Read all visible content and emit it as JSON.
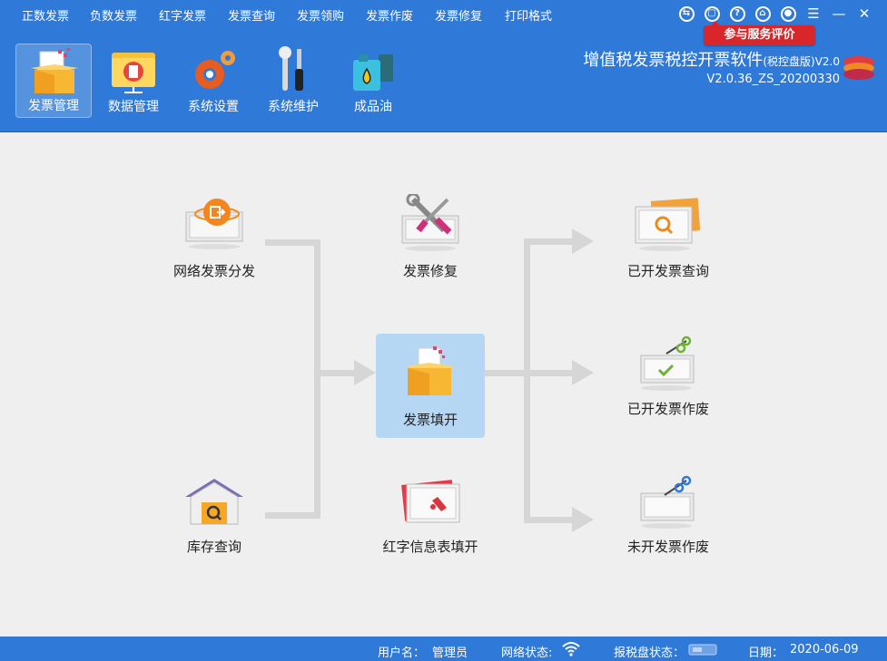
{
  "menu": [
    "正数发票",
    "负数发票",
    "红字发票",
    "发票查询",
    "发票领购",
    "发票作废",
    "发票修复",
    "打印格式"
  ],
  "rate_button": "参与服务评价",
  "toolbar": [
    {
      "label": "发票管理",
      "icon": "invoice-box-icon",
      "active": true
    },
    {
      "label": "数据管理",
      "icon": "folder-data-icon",
      "active": false
    },
    {
      "label": "系统设置",
      "icon": "gears-icon",
      "active": false
    },
    {
      "label": "系统维护",
      "icon": "tools-icon",
      "active": false
    },
    {
      "label": "成品油",
      "icon": "oil-barrel-icon",
      "active": false
    }
  ],
  "app": {
    "title_main": "增值税发票税控开票软件",
    "title_paren": "(税控盘版)",
    "title_version": "V2.0",
    "version": "V2.0.36_ZS_20200330"
  },
  "flow": {
    "network_dispatch": "网络发票分发",
    "inventory_query": "库存查询",
    "invoice_repair": "发票修复",
    "invoice_fill": "发票填开",
    "red_info_fill": "红字信息表填开",
    "issued_query": "已开发票查询",
    "issued_void": "已开发票作废",
    "unissued_void": "未开发票作废"
  },
  "status": {
    "user_label": "用户名：",
    "user_value": "管理员",
    "network_label": "网络状态:",
    "disk_label": "报税盘状态：",
    "date_label": "日期：",
    "date_value": "2020-06-09"
  },
  "colors": {
    "header_blue": "#2f79d9",
    "rate_red": "#d9262a",
    "center_highlight": "#b6d7f3",
    "connector_gray": "#d6d6d6"
  }
}
